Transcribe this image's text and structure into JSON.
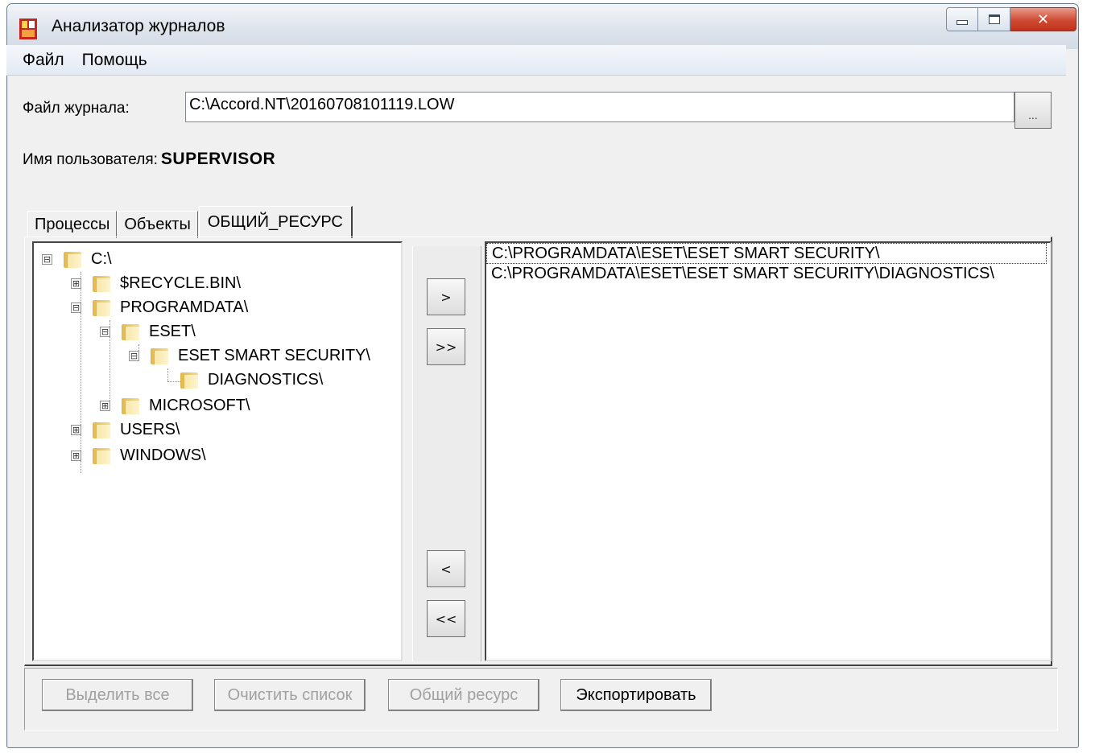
{
  "window": {
    "title": "Анализатор журналов"
  },
  "menu": [
    {
      "label": "Файл"
    },
    {
      "label": "Помощь"
    }
  ],
  "log_file": {
    "label": "Файл журнала:",
    "value": "C:\\Accord.NT\\20160708101119.LOW",
    "browse_label": "..."
  },
  "user": {
    "label": "Имя пользователя:",
    "name": "SUPERVISOR"
  },
  "tabs": [
    {
      "label": "Процессы",
      "active": false
    },
    {
      "label": "Объекты",
      "active": false
    },
    {
      "label": "ОБЩИЙ_РЕСУРС",
      "active": true
    }
  ],
  "tree": {
    "root": "C:\\",
    "recycle": "$RECYCLE.BIN\\",
    "programdata": "PROGRAMDATA\\",
    "eset": "ESET\\",
    "eset_smart": "ESET SMART SECURITY\\",
    "diagnostics": "DIAGNOSTICS\\",
    "microsoft": "MICROSOFT\\",
    "users": "USERS\\",
    "windows": "WINDOWS\\",
    "expand_symbol": "⊞",
    "collapse_symbol": "⊟"
  },
  "move_buttons": {
    "add": ">",
    "add_all": ">>",
    "remove": "<",
    "remove_all": "<<"
  },
  "selected_list": [
    "C:\\PROGRAMDATA\\ESET\\ESET SMART SECURITY\\",
    "C:\\PROGRAMDATA\\ESET\\ESET SMART SECURITY\\DIAGNOSTICS\\"
  ],
  "actions": {
    "select_all": "Выделить все",
    "clear_list": "Очистить список",
    "shared_resource": "Общий ресурс",
    "export": "Экспортировать"
  }
}
